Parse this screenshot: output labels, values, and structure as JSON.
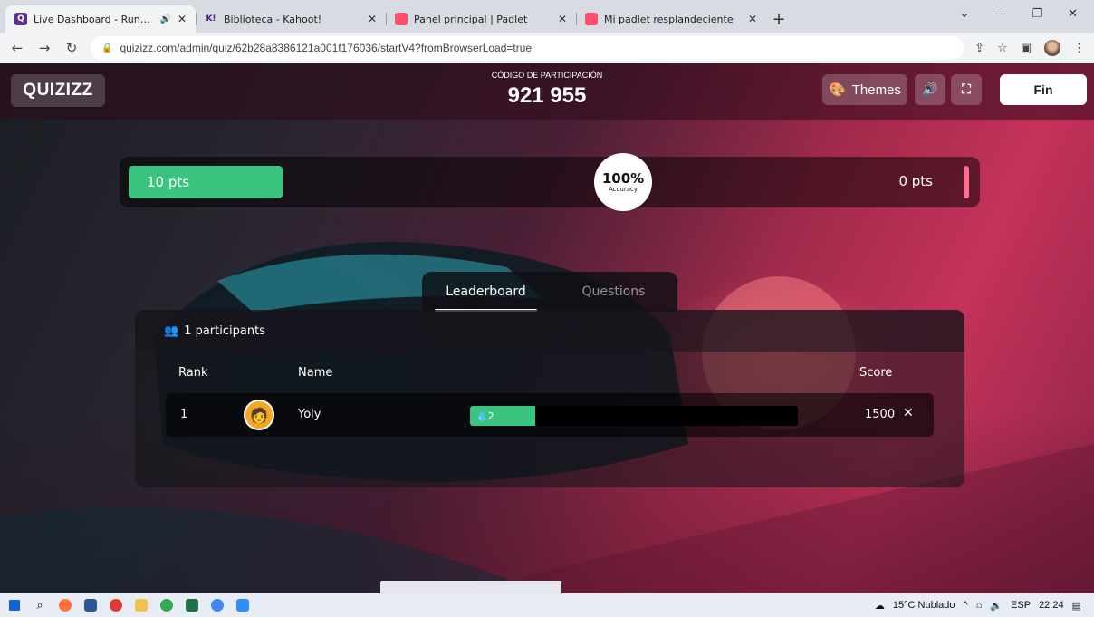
{
  "browser": {
    "tabs": [
      {
        "title": "Live Dashboard - Running",
        "active": true,
        "fav_color": "#5b2e8a"
      },
      {
        "title": "Biblioteca - Kahoot!",
        "active": false,
        "fav_color": "#46178f"
      },
      {
        "title": "Panel principal | Padlet",
        "active": false,
        "fav_color": "#ff4f6e"
      },
      {
        "title": "Mi padlet resplandeciente",
        "active": false,
        "fav_color": "#ff4f6e"
      }
    ],
    "url": "quizizz.com/admin/quiz/62b28a8386121a001f176036/startV4?fromBrowserLoad=true"
  },
  "header": {
    "logo": "QUIZIZZ",
    "code_label": "CÓDIGO DE PARTICIPACIÓN",
    "code_value": "921 955",
    "themes_label": "Themes",
    "fin_label": "Fin"
  },
  "scoreboard": {
    "left_pts": "10 pts",
    "right_pts": "0 pts",
    "accuracy_value": "100%",
    "accuracy_label": "Accuracy"
  },
  "tabs": {
    "leaderboard": "Leaderboard",
    "questions": "Questions"
  },
  "leaderboard": {
    "participants": "1 participants",
    "col_rank": "Rank",
    "col_name": "Name",
    "col_score": "Score",
    "rows": [
      {
        "rank": "1",
        "name": "Yoly",
        "correct": "2",
        "progress_fraction": 0.2,
        "score": "1500"
      }
    ]
  },
  "taskbar": {
    "weather": "15°C Nublado",
    "lang": "ESP",
    "time": "22:24"
  },
  "colors": {
    "green": "#3ac47f",
    "pink": "#ff6f8f"
  }
}
